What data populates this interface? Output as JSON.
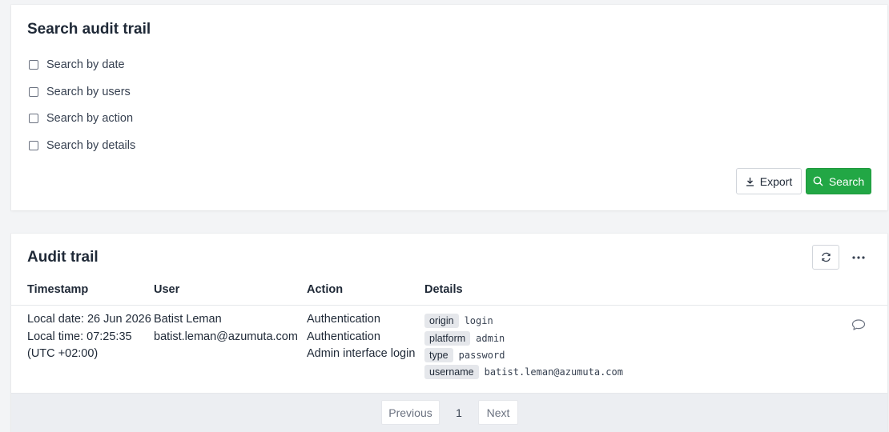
{
  "search_panel": {
    "title": "Search audit trail",
    "options": [
      {
        "label": "Search by date",
        "checked": false
      },
      {
        "label": "Search by users",
        "checked": false
      },
      {
        "label": "Search by action",
        "checked": false
      },
      {
        "label": "Search by details",
        "checked": false
      }
    ],
    "export_label": "Export",
    "search_label": "Search",
    "colors": {
      "search_button": "#22a745"
    }
  },
  "audit_panel": {
    "title": "Audit trail",
    "columns": [
      "Timestamp",
      "User",
      "Action",
      "Details"
    ],
    "rows": [
      {
        "timestamp": [
          "Local date: 26 Jun 2026",
          "Local time: 07:25:35",
          "(UTC +02:00)"
        ],
        "user": [
          "Batist Leman",
          "batist.leman@azumuta.com"
        ],
        "action": [
          "Authentication",
          "Authentication",
          "Admin interface login"
        ],
        "details": [
          {
            "key": "origin",
            "value": "login"
          },
          {
            "key": "platform",
            "value": "admin"
          },
          {
            "key": "type",
            "value": "password"
          },
          {
            "key": "username",
            "value": "batist.leman@azumuta.com"
          }
        ]
      }
    ],
    "icons": {
      "refresh": "refresh-icon",
      "more": "more-horizontal-icon",
      "comment": "comment-icon"
    }
  },
  "pagination": {
    "previous_label": "Previous",
    "current_page": "1",
    "next_label": "Next"
  }
}
